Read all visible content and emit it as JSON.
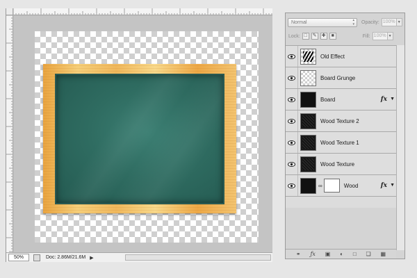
{
  "canvas": {
    "zoom": "50%",
    "doc_info": "Doc: 2.86M/21.6M",
    "status_arrow": "▶"
  },
  "layers_panel": {
    "blend_mode": "Normal",
    "opacity_label": "Opacity:",
    "opacity_value": "100%",
    "lock_label": "Lock:",
    "fill_label": "Fill:",
    "fill_value": "100%",
    "layers": [
      {
        "name": "Old Effect",
        "thumb": "checker-ink",
        "fx": false
      },
      {
        "name": "Board Grunge",
        "thumb": "checker",
        "fx": false
      },
      {
        "name": "Board",
        "thumb": "solid",
        "fx": true
      },
      {
        "name": "Wood Texture 2",
        "thumb": "texture",
        "fx": false
      },
      {
        "name": "Wood Texture 1",
        "thumb": "texture",
        "fx": false
      },
      {
        "name": "Wood Texture",
        "thumb": "texture",
        "fx": false
      },
      {
        "name": "Wood",
        "thumb": "solid-with-mask",
        "fx": true
      }
    ],
    "fx_label": "fx",
    "footer_icons": [
      "link-layers-icon",
      "fx-icon",
      "mask-icon",
      "adjustment-icon",
      "group-icon",
      "new-layer-icon",
      "trash-icon"
    ]
  },
  "colors": {
    "board": "#2f6c61",
    "frame": "#f0b85c",
    "panel_bg": "#d4d4d4"
  }
}
